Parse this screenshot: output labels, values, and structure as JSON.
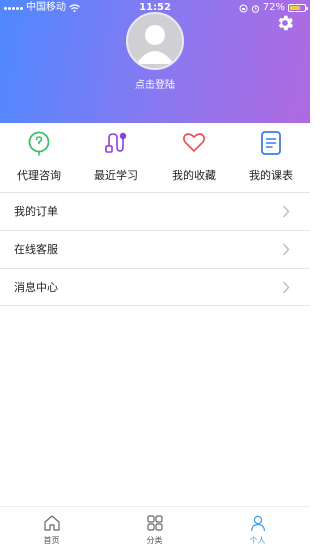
{
  "status_bar": {
    "carrier": "中国移动",
    "time": "11:52",
    "battery": "72%",
    "battery_level": 0.72
  },
  "profile": {
    "login_label": "点击登陆"
  },
  "quick_actions": [
    {
      "label": "代理咨询",
      "icon": "question-bubble-icon",
      "color": "#3cbf6a"
    },
    {
      "label": "最近学习",
      "icon": "learning-path-icon",
      "color": "#8a3fe0"
    },
    {
      "label": "我的收藏",
      "icon": "heart-icon",
      "color": "#e8545a"
    },
    {
      "label": "我的课表",
      "icon": "document-icon",
      "color": "#3a7fe8"
    }
  ],
  "menu": [
    {
      "label": "我的订单"
    },
    {
      "label": "在线客服"
    },
    {
      "label": "消息中心"
    }
  ],
  "tabs": [
    {
      "label": "首页",
      "icon": "home-icon"
    },
    {
      "label": "分类",
      "icon": "grid-icon"
    },
    {
      "label": "个人",
      "icon": "person-icon",
      "active": true
    }
  ],
  "colors": {
    "header_gradient_start": "#4f88ff",
    "header_gradient_end": "#b06ae0",
    "active_tab": "#3aa3e8"
  }
}
